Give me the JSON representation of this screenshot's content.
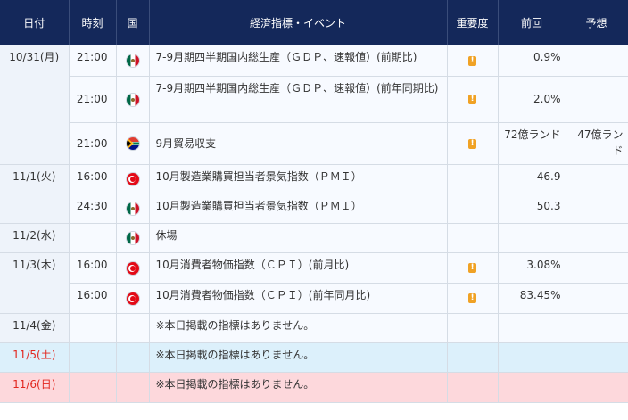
{
  "headers": {
    "date": "日付",
    "time": "時刻",
    "country": "国",
    "event": "経済指標・イベント",
    "importance": "重要度",
    "previous": "前回",
    "forecast": "予想"
  },
  "importance_icon": "!",
  "colors": {
    "header_bg": "#14285a",
    "saturday_bg": "#dcf0fb",
    "sunday_bg": "#fdd8dc",
    "weekend_date_text": "#e2261e",
    "importance_icon": "#f0a225"
  },
  "rows": [
    {
      "date": "10/31(月)",
      "time": "21:00",
      "flag": "mexico-flag-icon",
      "event": "7-9月期四半期国内総生産（ＧＤＰ、速報値）(前期比)",
      "previous": "0.9%",
      "forecast": ""
    },
    {
      "date": "",
      "time": "21:00",
      "flag": "mexico-flag-icon",
      "event": "7-9月期四半期国内総生産（ＧＤＰ、速報値）(前年同期比)",
      "previous": "2.0%",
      "forecast": ""
    },
    {
      "date": "",
      "time": "21:00",
      "flag": "south-africa-flag-icon",
      "event": "9月貿易収支",
      "previous": "72億ランド",
      "forecast": "47億ランド"
    },
    {
      "date": "11/1(火)",
      "time": "16:00",
      "flag": "turkey-flag-icon",
      "event": "10月製造業購買担当者景気指数（ＰＭＩ）",
      "previous": "46.9",
      "forecast": ""
    },
    {
      "date": "",
      "time": "24:30",
      "flag": "mexico-flag-icon",
      "event": "10月製造業購買担当者景気指数（ＰＭＩ）",
      "previous": "50.3",
      "forecast": ""
    },
    {
      "date": "11/2(水)",
      "time": "",
      "flag": "mexico-flag-icon",
      "event": "休場",
      "previous": "",
      "forecast": ""
    },
    {
      "date": "11/3(木)",
      "time": "16:00",
      "flag": "turkey-flag-icon",
      "event": "10月消費者物価指数（ＣＰＩ）(前月比)",
      "previous": "3.08%",
      "forecast": ""
    },
    {
      "date": "",
      "time": "16:00",
      "flag": "turkey-flag-icon",
      "event": "10月消費者物価指数（ＣＰＩ）(前年同月比)",
      "previous": "83.45%",
      "forecast": ""
    },
    {
      "date": "11/4(金)",
      "event": "※本日掲載の指標はありません。"
    },
    {
      "date": "11/5(土)",
      "event": "※本日掲載の指標はありません。"
    },
    {
      "date": "11/6(日)",
      "event": "※本日掲載の指標はありません。"
    }
  ]
}
